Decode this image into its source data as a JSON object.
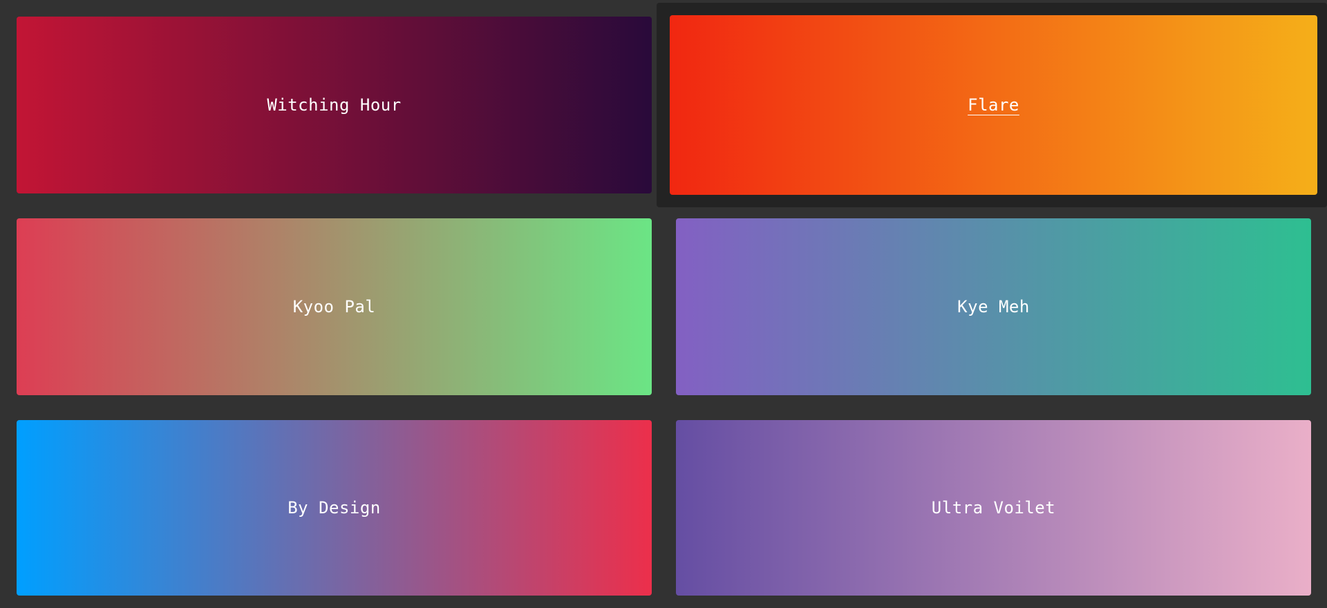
{
  "gradients": [
    {
      "name": "Witching Hour",
      "colors": [
        "#c21535",
        "#290a3a"
      ],
      "active": false
    },
    {
      "name": "Flare",
      "colors": [
        "#f12711",
        "#f5af19"
      ],
      "active": true
    },
    {
      "name": "Kyoo Pal",
      "colors": [
        "#dd3e54",
        "#6be585"
      ],
      "active": false
    },
    {
      "name": "Kye Meh",
      "colors": [
        "#8360c3",
        "#2ebf91"
      ],
      "active": false
    },
    {
      "name": "By Design",
      "colors": [
        "#009fff",
        "#ec2f4b"
      ],
      "active": false
    },
    {
      "name": "Ultra Voilet",
      "colors": [
        "#654ea3",
        "#eaafc8"
      ],
      "active": false
    }
  ]
}
